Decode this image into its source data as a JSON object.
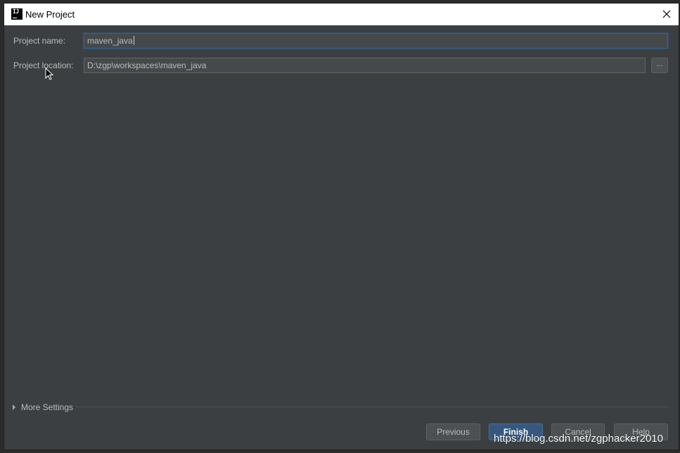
{
  "window": {
    "title": "New Project",
    "app_icon_text": "IJ",
    "close_icon": "close-icon"
  },
  "form": {
    "project_name_label": "Project name:",
    "project_name_value": "maven_java",
    "project_location_label": "Project location:",
    "project_location_value": "D:\\zgp\\workspaces\\maven_java",
    "browse_label": "..."
  },
  "more_settings": {
    "label": "More Settings",
    "expanded": false
  },
  "buttons": {
    "previous": "Previous",
    "finish": "Finish",
    "cancel": "Cancel",
    "help": "Help"
  },
  "watermark": "https://blog.csdn.net/zgphacker2010",
  "colors": {
    "background": "#3c3f41",
    "field": "#45494a",
    "accent_focus": "#3d6185",
    "default_button": "#365880",
    "text": "#bbbbbb"
  }
}
